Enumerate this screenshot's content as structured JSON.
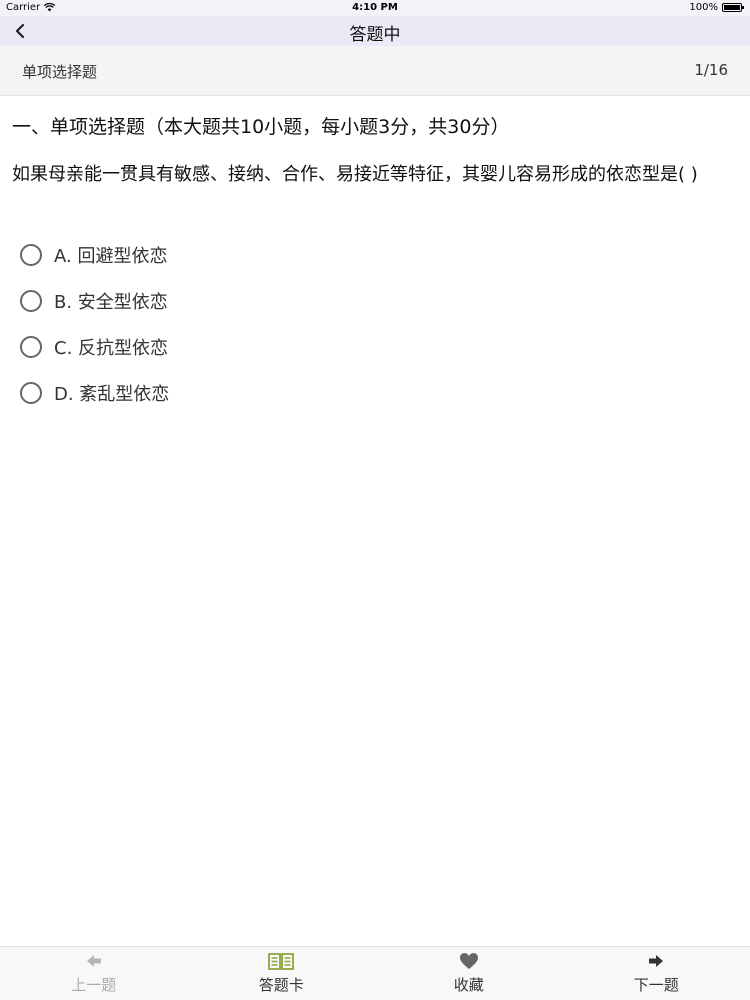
{
  "status_bar": {
    "carrier": "Carrier",
    "time": "4:10 PM",
    "battery": "100%"
  },
  "nav": {
    "title": "答题中",
    "back_icon": "chevron-left-icon"
  },
  "sub_header": {
    "question_type": "单项选择题",
    "progress": "1/16"
  },
  "section_title": "一、单项选择题（本大题共10小题，每小题3分，共30分）",
  "question": "如果母亲能一贯具有敏感、接纳、合作、易接近等特征，其婴儿容易形成的依恋型是(   )",
  "options": [
    {
      "label": "A. 回避型依恋",
      "selected": false
    },
    {
      "label": "B. 安全型依恋",
      "selected": false
    },
    {
      "label": "C. 反抗型依恋",
      "selected": false
    },
    {
      "label": "D. 紊乱型依恋",
      "selected": false
    }
  ],
  "tab_bar": {
    "items": [
      {
        "label": "上一题",
        "icon": "arrow-left-icon",
        "enabled": false
      },
      {
        "label": "答题卡",
        "icon": "book-icon",
        "enabled": true
      },
      {
        "label": "收藏",
        "icon": "heart-icon",
        "enabled": true
      },
      {
        "label": "下一题",
        "icon": "arrow-right-icon",
        "enabled": true
      }
    ]
  },
  "colors": {
    "nav_background": "#eaeaf6",
    "sub_header_background": "#f4f4f4",
    "book_icon": "#8aa33a",
    "disabled_icon": "#b5b5b5",
    "icon_dark": "#333333",
    "heart_icon": "#666666"
  }
}
